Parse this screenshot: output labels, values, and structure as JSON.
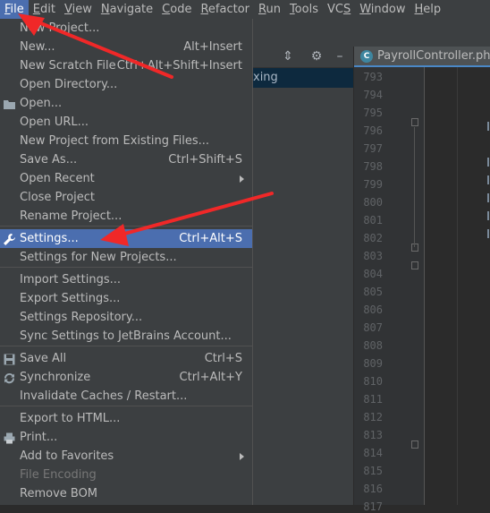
{
  "menubar": {
    "items": [
      {
        "label": "File",
        "mnemonic": "F",
        "rest": "ile",
        "active": true
      },
      {
        "label": "Edit",
        "mnemonic": "E",
        "rest": "dit",
        "active": false
      },
      {
        "label": "View",
        "mnemonic": "V",
        "rest": "iew",
        "active": false
      },
      {
        "label": "Navigate",
        "mnemonic": "N",
        "rest": "avigate",
        "active": false
      },
      {
        "label": "Code",
        "mnemonic": "C",
        "rest": "ode",
        "active": false
      },
      {
        "label": "Refactor",
        "mnemonic": "R",
        "rest": "efactor",
        "active": false
      },
      {
        "label": "Run",
        "mnemonic": "R",
        "rest": "un",
        "active": false
      },
      {
        "label": "Tools",
        "mnemonic": "T",
        "rest": "ools",
        "active": false
      },
      {
        "label": "VCS",
        "mnemonic": "S",
        "rest": "",
        "prefix": "VC",
        "active": false
      },
      {
        "label": "Window",
        "mnemonic": "W",
        "rest": "indow",
        "active": false
      },
      {
        "label": "Help",
        "mnemonic": "H",
        "rest": "elp",
        "active": false
      }
    ]
  },
  "file_menu": {
    "items": [
      {
        "label": "New Project...",
        "shortcut": "",
        "submenu": false
      },
      {
        "label": "New...",
        "shortcut": "Alt+Insert",
        "submenu": false
      },
      {
        "label": "New Scratch File",
        "shortcut": "Ctrl+Alt+Shift+Insert",
        "submenu": false
      },
      {
        "label": "Open Directory...",
        "shortcut": "",
        "submenu": false
      },
      {
        "label": "Open...",
        "shortcut": "",
        "submenu": false,
        "icon": "folder-icon"
      },
      {
        "label": "Open URL...",
        "shortcut": "",
        "submenu": false
      },
      {
        "label": "New Project from Existing Files...",
        "shortcut": "",
        "submenu": false
      },
      {
        "label": "Save As...",
        "shortcut": "Ctrl+Shift+S",
        "submenu": false
      },
      {
        "label": "Open Recent",
        "shortcut": "",
        "submenu": true
      },
      {
        "label": "Close Project",
        "shortcut": "",
        "submenu": false
      },
      {
        "label": "Rename Project...",
        "shortcut": "",
        "submenu": false
      },
      {
        "label": "Settings...",
        "shortcut": "Ctrl+Alt+S",
        "submenu": false,
        "icon": "wrench-icon",
        "selected": true
      },
      {
        "label": "Settings for New Projects...",
        "shortcut": "",
        "submenu": false
      },
      {
        "label": "Import Settings...",
        "shortcut": "",
        "submenu": false
      },
      {
        "label": "Export Settings...",
        "shortcut": "",
        "submenu": false
      },
      {
        "label": "Settings Repository...",
        "shortcut": "",
        "submenu": false
      },
      {
        "label": "Sync Settings to JetBrains Account...",
        "shortcut": "",
        "submenu": false
      },
      {
        "label": "Save All",
        "shortcut": "Ctrl+S",
        "submenu": false,
        "icon": "save-icon"
      },
      {
        "label": "Synchronize",
        "shortcut": "Ctrl+Alt+Y",
        "submenu": false,
        "icon": "sync-icon"
      },
      {
        "label": "Invalidate Caches / Restart...",
        "shortcut": "",
        "submenu": false
      },
      {
        "label": "Export to HTML...",
        "shortcut": "",
        "submenu": false
      },
      {
        "label": "Print...",
        "shortcut": "",
        "submenu": false,
        "icon": "print-icon"
      },
      {
        "label": "Add to Favorites",
        "shortcut": "",
        "submenu": true
      },
      {
        "label": "File Encoding",
        "shortcut": "",
        "submenu": false,
        "disabled": true
      },
      {
        "label": "Remove BOM",
        "shortcut": "",
        "submenu": false
      }
    ]
  },
  "project_panel": {
    "selected_node_text": "xing",
    "tool_icons": [
      "collapse-icon",
      "gear-icon",
      "minimize-icon"
    ]
  },
  "editor": {
    "tab_label": "PayrollController.php",
    "tab_icon_letter": "C",
    "line_numbers": [
      "793",
      "794",
      "795",
      "796",
      "797",
      "798",
      "799",
      "800",
      "801",
      "802",
      "803",
      "804",
      "805",
      "806",
      "807",
      "808",
      "809",
      "810",
      "811",
      "812",
      "813",
      "814",
      "815",
      "816",
      "817"
    ]
  },
  "colors": {
    "accent": "#4b6eaf",
    "annotation_arrow": "#f02828",
    "menu_bg": "#3c3f41",
    "editor_bg": "#2b2b2b"
  }
}
